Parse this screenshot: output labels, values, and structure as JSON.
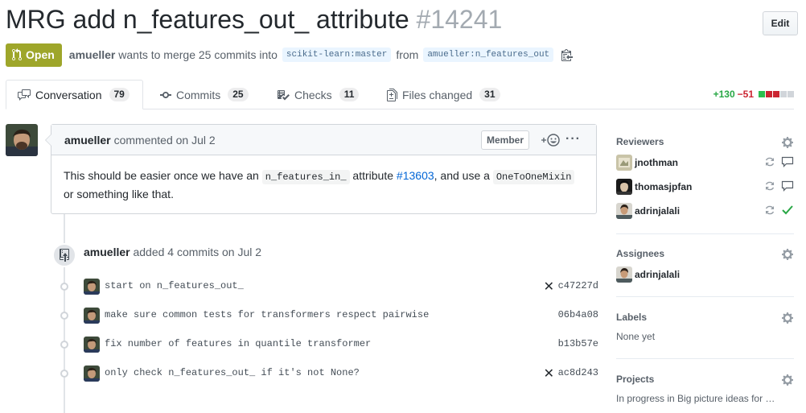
{
  "pr": {
    "title": "MRG add n_features_out_ attribute",
    "number": "#14241",
    "edit_label": "Edit",
    "state": "Open",
    "author": "amueller",
    "merge_text": "wants to merge 25 commits into",
    "base_branch": "scikit-learn:master",
    "from_text": "from",
    "head_branch": "amueller:n_features_out"
  },
  "tabs": [
    {
      "label": "Conversation",
      "count": "79",
      "icon": "comment-discussion-icon"
    },
    {
      "label": "Commits",
      "count": "25",
      "icon": "git-commit-icon"
    },
    {
      "label": "Checks",
      "count": "11",
      "icon": "checklist-icon"
    },
    {
      "label": "Files changed",
      "count": "31",
      "icon": "file-diff-icon"
    }
  ],
  "diffstat": {
    "additions": "+130",
    "deletions": "−51",
    "colors": [
      "#2cbe4e",
      "#cb2431",
      "#cb2431",
      "#d1d5da",
      "#d1d5da"
    ]
  },
  "comment": {
    "author": "amueller",
    "timestamp": "commented on Jul 2",
    "role": "Member",
    "body_before": "This should be easier once we have an ",
    "code1": "n_features_in_",
    "body_mid1": " attribute ",
    "link": "#13603",
    "body_mid2": ", and use a ",
    "code2": "OneToOneMixin",
    "body_after": " or something like that."
  },
  "commits_event": {
    "author": "amueller",
    "text": "added 4 commits",
    "timestamp": "on Jul 2",
    "commits": [
      {
        "message": "start on n_features_out_",
        "sha": "c47227d",
        "status": "failed"
      },
      {
        "message": "make sure common tests for transformers respect pairwise",
        "sha": "06b4a08",
        "status": "none"
      },
      {
        "message": "fix number of features in quantile transformer",
        "sha": "b13b57e",
        "status": "none"
      },
      {
        "message": "only check n_features_out_ if it's not None?",
        "sha": "ac8d243",
        "status": "failed"
      }
    ]
  },
  "sidebar": {
    "reviewers_title": "Reviewers",
    "reviewers": [
      {
        "name": "jnothman",
        "state": "commented"
      },
      {
        "name": "thomasjpfan",
        "state": "commented"
      },
      {
        "name": "adrinjalali",
        "state": "approved"
      }
    ],
    "assignees_title": "Assignees",
    "assignees": [
      "adrinjalali"
    ],
    "labels_title": "Labels",
    "labels_value": "None yet",
    "projects_title": "Projects",
    "projects_value": "In progress in Big picture ideas for …"
  }
}
